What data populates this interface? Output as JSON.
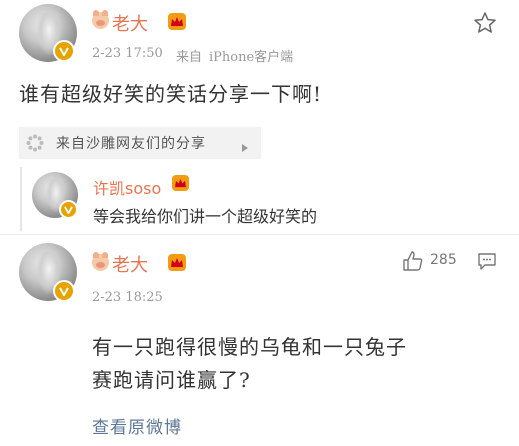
{
  "post": {
    "username": "老大",
    "date": "2-23 17:50",
    "source_prefix": "来自",
    "source": "iPhone客户端",
    "text": "谁有超级好笑的笑话分享一下啊!"
  },
  "shared_from": {
    "text": "来自沙雕网友们的分享"
  },
  "comment1": {
    "username": "许凯soso",
    "text": "等会我给你们讲一个超级好笑的"
  },
  "comment2": {
    "username": "老大",
    "date": "2-23 18:25",
    "like_count": "285",
    "text_line1": "有一只跑得很慢的乌龟和一只兔子",
    "text_line2": "赛跑请问谁赢了?",
    "view_original": "查看原微博"
  },
  "colors": {
    "username": "#eb7350",
    "comment_username": "#eb7350",
    "meta": "#999999",
    "link": "#5d7897",
    "badge": "#e8a300"
  },
  "icons": [
    "avatar",
    "verified-badge-icon",
    "pig-emoji-icon",
    "crown-badge-icon",
    "star-icon",
    "loading-icon",
    "chevron-right-icon",
    "thumbs-up-icon",
    "comment-icon"
  ]
}
